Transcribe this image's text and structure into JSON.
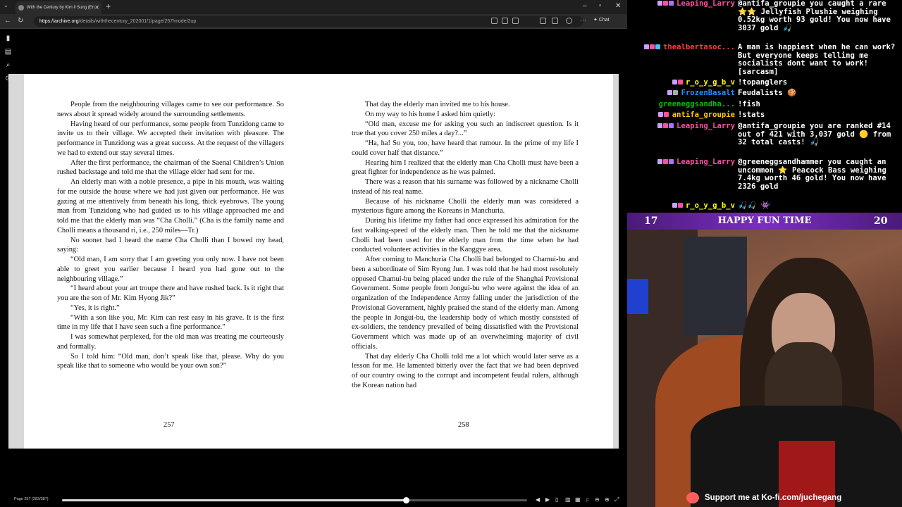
{
  "browser": {
    "tab_title": "With the Century by Kim Il Sung (En...",
    "url_host": "https://archive.org",
    "url_path": "/details/withthecentury_202001/1/page/257/mode/2up",
    "chat_label": "Chat"
  },
  "reader": {
    "left_page": {
      "number": "257",
      "paragraphs": [
        {
          "text": "People from the neighbouring villages came to see our performance. So news about it spread widely around the surrounding settlements.",
          "indent": true
        },
        {
          "text": "Having heard of our performance, some people from Tunzidong came to invite us to their village. We accepted their invitation with pleasure. The performance in Tunzidong was a great success. At the request of the villagers we had to extend our stay several times.",
          "indent": true
        },
        {
          "text": "After the first performance, the chairman of the Saenal Children’s Union rushed backstage and told me that the village elder had sent for me.",
          "indent": true
        },
        {
          "text": "An elderly man with a noble presence, a pipe in his mouth, was waiting for me outside the house where we had just given our performance. He was gazing at me attentively from beneath his long, thick eyebrows. The young man from Tunzidong who had guided us to his village approached me and told me that the elderly man was “Cha Cholli.” (Cha is the family name and Cholli means a thousand ri, i.e., 250 miles—Tr.)",
          "indent": true
        },
        {
          "text": "No sooner had I heard the name Cha Cholli than I bowed my head, saying:",
          "indent": true
        },
        {
          "text": "“Old man, I am sorry that I am greeting you only now. I have not been able to greet you earlier because I heard you had gone out to the neighbouring village.”",
          "indent": true
        },
        {
          "text": "“I heard about your art troupe there and have rushed back. Is it right that you are the son of Mr. Kim Hyong Jik?”",
          "indent": true
        },
        {
          "text": "“Yes, it is right.”",
          "indent": true
        },
        {
          "text": "“With a son like you, Mr. Kim can rest easy in his grave. It is the first time in my life that I have seen such a fine performance.”",
          "indent": true
        },
        {
          "text": "I was somewhat perplexed, for the old man was treating me courteously and formally.",
          "indent": true
        },
        {
          "text": "So I told him: “Old man, don’t speak like that, please. Why do you speak like that to someone who would be your own son?”",
          "indent": true
        }
      ]
    },
    "right_page": {
      "number": "258",
      "paragraphs": [
        {
          "text": "That day the elderly man invited me to his house.",
          "indent": true
        },
        {
          "text": "On my way to his home I asked him quietly:",
          "indent": true
        },
        {
          "text": "“Old man, excuse me for asking you such an indiscreet question. Is it true that you cover 250 miles a day?...”",
          "indent": true
        },
        {
          "text": "“Ha, ha! So you, too, have heard that rumour. In the prime of my life I could cover half that distance.”",
          "indent": true
        },
        {
          "text": "Hearing him I realized that the elderly man Cha Cholli must have been a great fighter for independence as he was painted.",
          "indent": true
        },
        {
          "text": "There was a reason that his surname was followed by a nickname Cholli instead of his real name.",
          "indent": true
        },
        {
          "text": "Because of his nickname Cholli the elderly man was considered a mysterious figure among the Koreans in Manchuria.",
          "indent": true
        },
        {
          "text": "During his lifetime my father had once expressed his admiration for the fast walking-speed of the elderly man. Then he told me that the nickname Cholli had been used for the elderly man from the time when he had conducted volunteer activities in the Kanggye area.",
          "indent": true
        },
        {
          "text": "After coming to Manchuria Cha Cholli had belonged to Chamui-bu and been a subordinate of Sim Ryong Jun. I was told that he had most resolutely opposed Chamui-bu being placed under the rule of the Shanghai Provisional Government. Some people from Jongui-bu who were against the idea of an organization of the Independence Army falling under the jurisdiction of the Provisional Government, highly praised the stand of the elderly man. Among the people in Jongui-bu, the leadership body of which mostly consisted of ex-soldiers, the tendency prevailed of being dissatisfied with the Provisional Government which was made up of an overwhelming majority of civil officials.",
          "indent": true
        },
        {
          "text": "That day elderly Cha Cholli told me a lot which would later serve as a lesson for me. He lamented bitterly over the fact that we had been deprived of our country owing to the corrupt and incompetent feudal rulers, although the Korean nation had",
          "indent": true
        }
      ]
    },
    "page_label": "Page 257 (283/387)",
    "progress_fraction": 0.74
  },
  "chat": {
    "messages": [
      {
        "user": "Leaping_Larry",
        "color": "#ff4fa0",
        "text": "@antifa_groupie you caught a rare ⭐⭐ Jellyfish Plushie weighing 0.52kg worth 93 gold! You now have 3037 gold 🎣",
        "badges": [
          "#c8a0ff",
          "#ff4fa0",
          "#b070ff"
        ]
      },
      {
        "user": "thealbertasoc...",
        "color": "#ff4040",
        "text": "A man is happiest when he can work? But everyone keeps telling me socialists dont want to work! [sarcasm]",
        "badges": [
          "#c8a0ff",
          "#ff4fa0",
          "#4fc0ff"
        ]
      },
      {
        "user": "r_o_y_g_b_v",
        "color": "#ffff00",
        "text": "!topanglers",
        "badges": [
          "#c8a0ff",
          "#ff4fa0"
        ]
      },
      {
        "user": "FrozenBasalt",
        "color": "#1e90ff",
        "text": "Feudalists 🍪",
        "badges": [
          "#c8a0ff",
          "#aaaaaa"
        ]
      },
      {
        "user": "greeneggsandha...",
        "color": "#00c000",
        "text": "!fish",
        "badges": []
      },
      {
        "user": "antifa_groupie",
        "color": "#ffcc00",
        "text": "!stats",
        "badges": [
          "#c8a0ff",
          "#ff4fa0"
        ]
      },
      {
        "user": "Leaping_Larry",
        "color": "#ff4fa0",
        "text": "@antifa_groupie you are ranked #14 out of 421 with 3,037 gold 🟡 from 32 total casts! 🎣",
        "badges": [
          "#c8a0ff",
          "#ff4fa0",
          "#b070ff"
        ]
      },
      {
        "user": "Leaping_Larry",
        "color": "#ff4fa0",
        "text": "@greeneggsandhammer you caught an uncommon ⭐ Peacock Bass weighing 7.4kg worth 46 gold! You now have 2326 gold",
        "badges": [
          "#c8a0ff",
          "#ff4fa0",
          "#b070ff"
        ]
      },
      {
        "user": "r_o_y_g_b_v",
        "color": "#ffff00",
        "text": "🎣🎣 👾",
        "badges": [
          "#c8a0ff",
          "#ff4fa0"
        ]
      }
    ]
  },
  "banner": {
    "left_number": "17",
    "title": "HAPPY FUN TIME",
    "right_number": "20"
  },
  "kofi": {
    "text": "Support me at Ko-fi.com/juchegang"
  }
}
